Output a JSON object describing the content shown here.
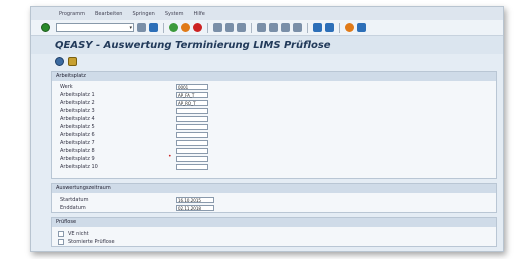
{
  "menubar": {
    "items": [
      "Programm",
      "Bearbeiten",
      "Springen",
      "System",
      "Hilfe"
    ]
  },
  "toolbar": {
    "command_field": ""
  },
  "title": "QEASY - Auswertung Terminierung LIMS Prüflose",
  "arbeitsplatz": {
    "header": "Arbeitsplatz",
    "rows": [
      {
        "label": "Werk",
        "value": "0001"
      },
      {
        "label": "Arbeitsplatz 1",
        "value": "AP_FA_T"
      },
      {
        "label": "Arbeitsplatz 2",
        "value": "AP_RO_T"
      },
      {
        "label": "Arbeitsplatz 3",
        "value": ""
      },
      {
        "label": "Arbeitsplatz 4",
        "value": ""
      },
      {
        "label": "Arbeitsplatz 5",
        "value": ""
      },
      {
        "label": "Arbeitsplatz 6",
        "value": ""
      },
      {
        "label": "Arbeitsplatz 7",
        "value": ""
      },
      {
        "label": "Arbeitsplatz 8",
        "value": ""
      },
      {
        "label": "Arbeitsplatz 9",
        "value": ""
      },
      {
        "label": "Arbeitsplatz 10",
        "value": ""
      }
    ]
  },
  "zeitraum": {
    "header": "Auswertungszeitraum",
    "start_label": "Startdatum",
    "start_value": "16.10.2015",
    "end_label": "Enddatum",
    "end_value": "02.11.2018"
  },
  "prueflose": {
    "header": "Prüflose",
    "cb1": "VE nicht",
    "cb2": "Stornierte Prüflose"
  }
}
